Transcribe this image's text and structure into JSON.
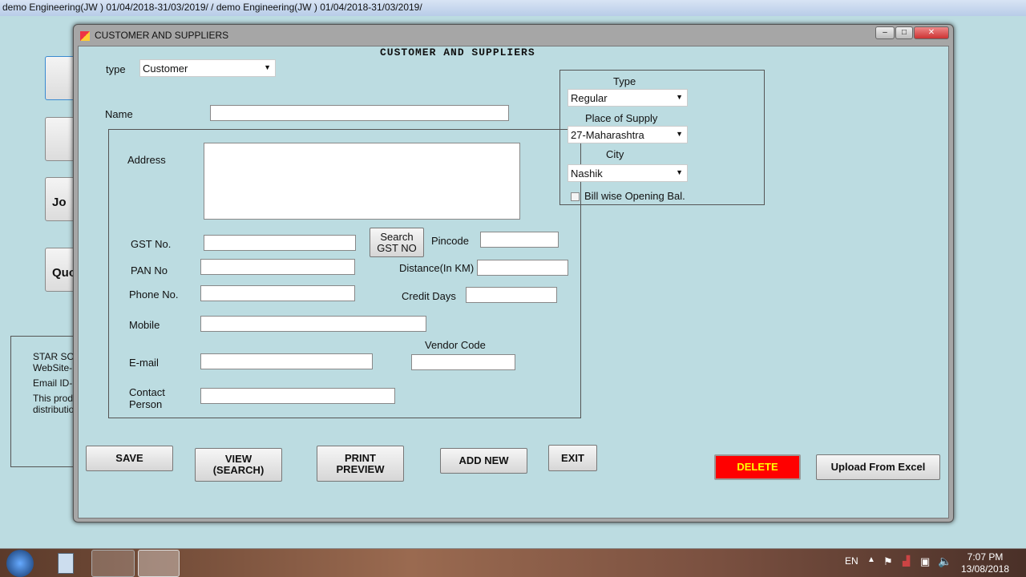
{
  "app_title": "demo Engineering(JW ) 01/04/2018-31/03/2019/ / demo Engineering(JW ) 01/04/2018-31/03/2019/",
  "background": {
    "buttons": [
      "",
      "",
      "Jo",
      "Quo"
    ],
    "info": [
      "STAR SO",
      "WebSite-",
      "Email ID-",
      "This prod",
      "distributio"
    ]
  },
  "window": {
    "title": "CUSTOMER AND SUPPLIERS",
    "heading": "CUSTOMER AND SUPPLIERS",
    "controls": [
      "–",
      "□",
      "✕"
    ]
  },
  "form": {
    "type_label": "type",
    "type_value": "Customer",
    "name_label": "Name",
    "address_label": "Address",
    "gst_label": "GST No.",
    "search_gst": "Search GST NO",
    "pincode_label": "Pincode",
    "pan_label": "PAN No",
    "distance_label": "Distance(In KM)",
    "phone_label": "Phone No.",
    "credit_label": "Credit Days",
    "mobile_label": "Mobile",
    "vendor_label": "Vendor Code",
    "email_label": "E-mail",
    "contact_label": "Contact Person"
  },
  "side": {
    "type_label": "Type",
    "type_value": "Regular",
    "pos_label": "Place of Supply",
    "pos_value": "27-Maharashtra",
    "city_label": "City",
    "city_value": "Nashik",
    "billwise_label": "Bill wise Opening Bal.",
    "billwise_checked": false
  },
  "buttons": {
    "save": "SAVE",
    "view": "VIEW (SEARCH)",
    "print": "PRINT PREVIEW",
    "add_new": "ADD NEW",
    "exit": "EXIT",
    "delete": "DELETE",
    "upload": "Upload From Excel"
  },
  "colors": {
    "delete_bg": "#ff0000",
    "delete_text": "#ffff00",
    "background": "#bcdce1"
  },
  "taskbar": {
    "lang": "EN",
    "time": "7:07 PM",
    "date": "13/08/2018"
  }
}
